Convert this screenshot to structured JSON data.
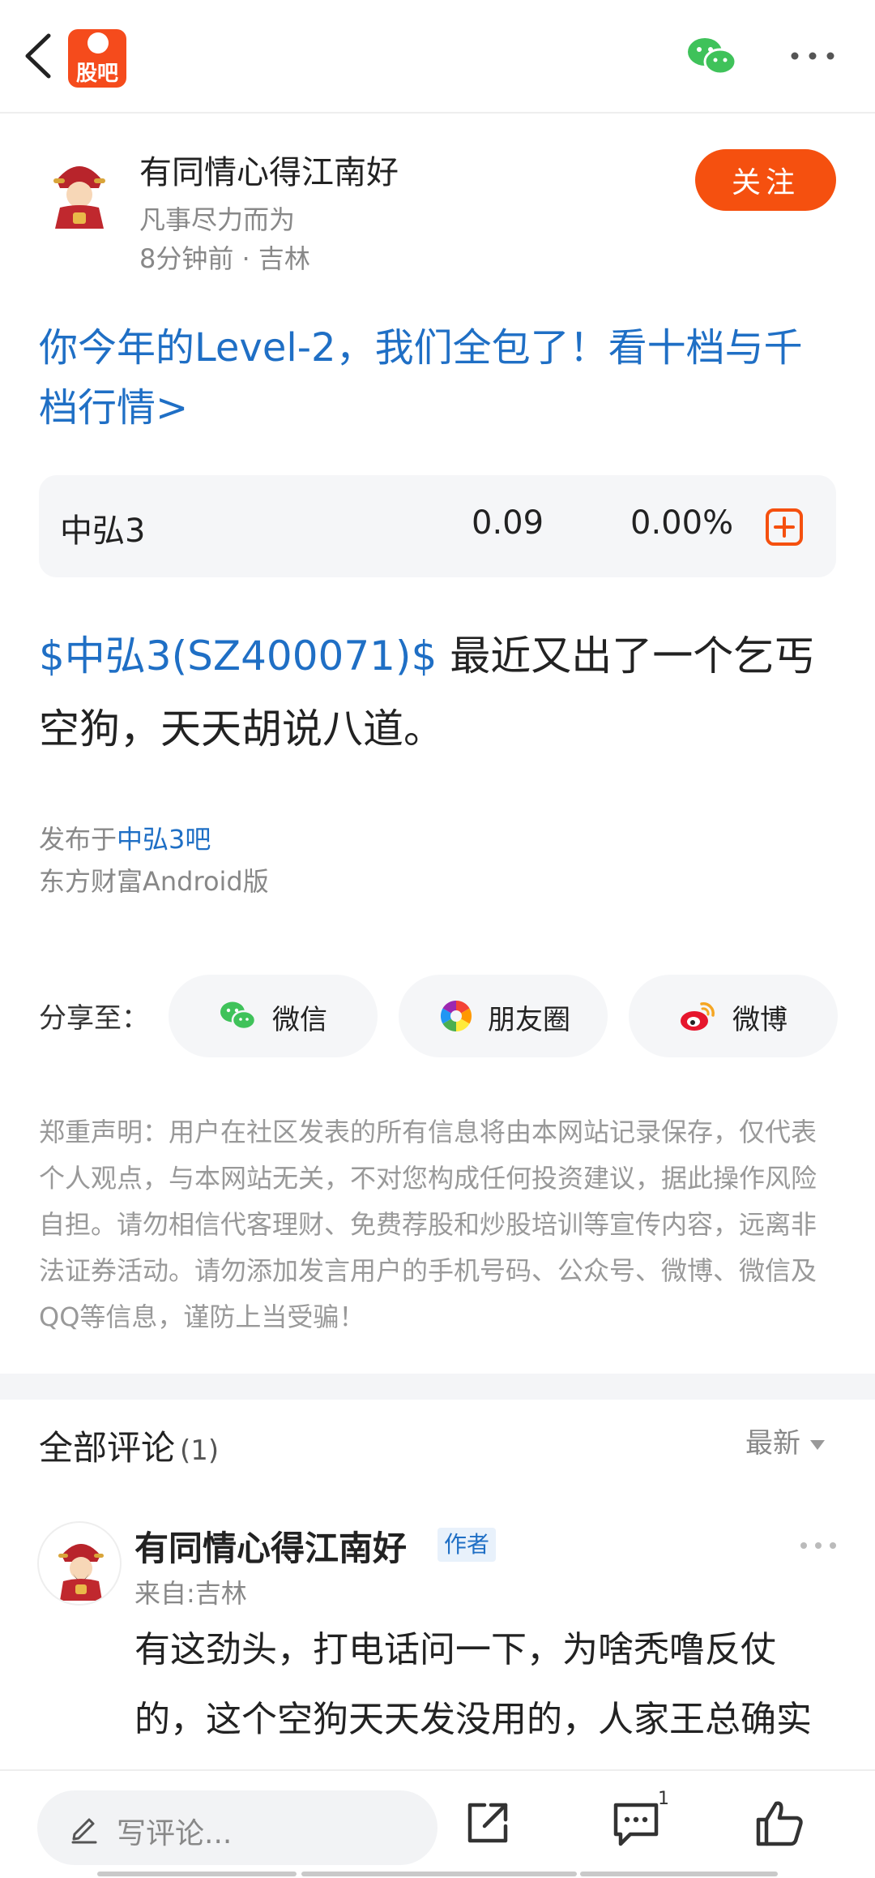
{
  "topbar": {
    "logo_text": "股吧"
  },
  "author": {
    "name": "有同情心得江南好",
    "signature": "凡事尽力而为",
    "meta": "8分钟前 · 吉林",
    "follow_label": "关注"
  },
  "promo": {
    "text": "你今年的Level-2，我们全包了！看十档与千档行情>"
  },
  "stock": {
    "name": "中弘3",
    "price": "0.09",
    "change": "0.00%"
  },
  "post": {
    "stock_tag": "$中弘3(SZ400071)$",
    "body": " 最近又出了一个乞丐空狗，天天胡说八道。"
  },
  "publish": {
    "prefix": "发布于",
    "board": "中弘3吧",
    "client": "东方财富Android版"
  },
  "share": {
    "label": "分享至：",
    "wechat": "微信",
    "moments": "朋友圈",
    "weibo": "微博"
  },
  "disclaimer": "郑重声明：用户在社区发表的所有信息将由本网站记录保存，仅代表个人观点，与本网站无关，不对您构成任何投资建议，据此操作风险自担。请勿相信代客理财、免费荐股和炒股培训等宣传内容，远离非法证券活动。请勿添加发言用户的手机号码、公众号、微博、微信及QQ等信息，谨防上当受骗！",
  "comments": {
    "title": "全部评论",
    "count": "(1)",
    "sort": "最新",
    "items": [
      {
        "author": "有同情心得江南好",
        "badge": "作者",
        "location": "来自:吉林",
        "text": "有这劲头，打电话问一下，为啥秃噜反仗的，这个空狗天天发没用的，人家王总确实是去过如意岛"
      }
    ]
  },
  "bottom": {
    "placeholder": "写评论...",
    "comment_count": "1"
  },
  "colors": {
    "brand_orange": "#f5500f",
    "link_blue": "#1f6fc5",
    "muted_gray": "#888888"
  }
}
